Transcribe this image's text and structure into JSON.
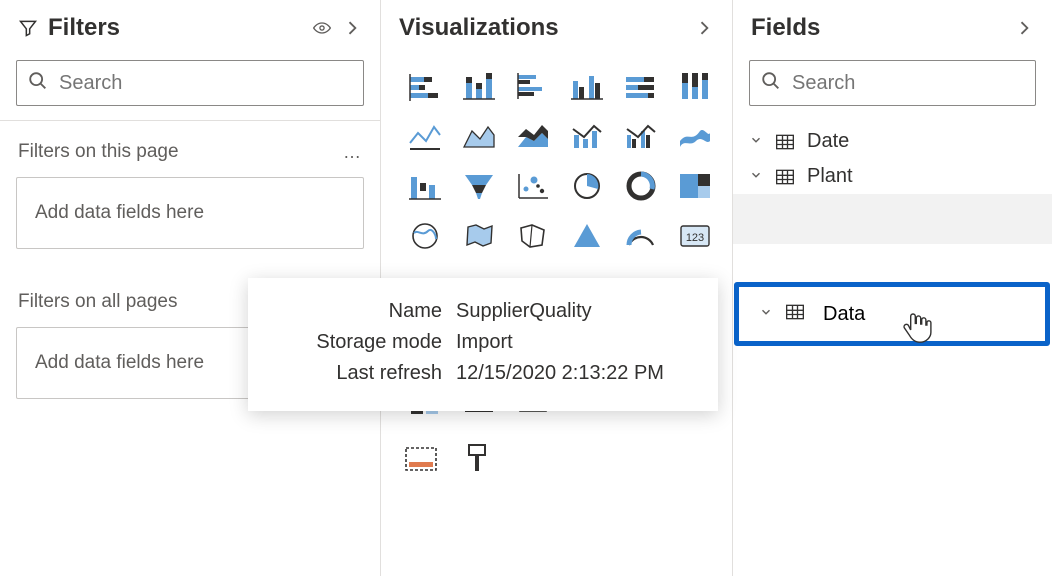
{
  "filters": {
    "title": "Filters",
    "search_placeholder": "Search",
    "section_page_label": "Filters on this page",
    "section_all_label": "Filters on all pages",
    "drop_text_page": "Add data fields here",
    "drop_text_all": "Add data fields here"
  },
  "visualizations": {
    "title": "Visualizations"
  },
  "fields": {
    "title": "Fields",
    "search_placeholder": "Search",
    "tables": [
      {
        "name": "Date"
      },
      {
        "name": "Plant"
      }
    ],
    "editing_value": "Data"
  },
  "tooltip": {
    "rows": [
      {
        "k": "Name",
        "v": "SupplierQuality"
      },
      {
        "k": "Storage mode",
        "v": "Import"
      },
      {
        "k": "Last refresh",
        "v": "12/15/2020 2:13:22 PM"
      }
    ]
  }
}
